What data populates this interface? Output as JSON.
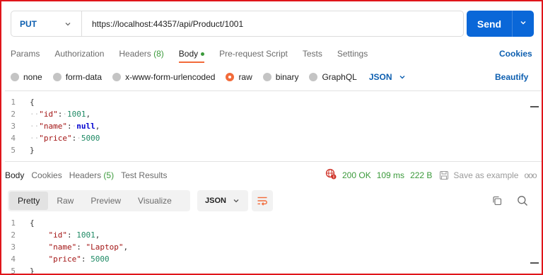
{
  "request": {
    "method": "PUT",
    "url": "https://localhost:44357/api/Product/1001",
    "send_label": "Send"
  },
  "request_tabs": [
    {
      "label": "Params"
    },
    {
      "label": "Authorization"
    },
    {
      "label": "Headers",
      "count": "(8)"
    },
    {
      "label": "Body",
      "active": true
    },
    {
      "label": "Pre-request Script"
    },
    {
      "label": "Tests"
    },
    {
      "label": "Settings"
    }
  ],
  "cookies_label": "Cookies",
  "body_types": [
    "none",
    "form-data",
    "x-www-form-urlencoded",
    "raw",
    "binary",
    "GraphQL"
  ],
  "selected_body_type": "raw",
  "body_format": "JSON",
  "beautify_label": "Beautify",
  "request_body": [
    {
      "n": "1",
      "text": "{"
    },
    {
      "n": "2",
      "key": "\"id\"",
      "value": "1001",
      "vtype": "num",
      "comma": ","
    },
    {
      "n": "3",
      "key": "\"name\"",
      "value": "null",
      "vtype": "kw",
      "comma": ","
    },
    {
      "n": "4",
      "key": "\"price\"",
      "value": "5000",
      "vtype": "num",
      "comma": ""
    },
    {
      "n": "5",
      "text": "}"
    }
  ],
  "response_tabs": [
    {
      "label": "Body",
      "active": true
    },
    {
      "label": "Cookies"
    },
    {
      "label": "Headers",
      "count": "(5)"
    },
    {
      "label": "Test Results"
    }
  ],
  "response_status": {
    "status": "200 OK",
    "time": "109 ms",
    "size": "222 B",
    "save_label": "Save as example",
    "more": "ooo"
  },
  "view_options": [
    "Pretty",
    "Raw",
    "Preview",
    "Visualize"
  ],
  "active_view": "Pretty",
  "response_format": "JSON",
  "response_body": [
    {
      "n": "1",
      "text": "{"
    },
    {
      "n": "2",
      "key": "\"id\"",
      "value": "1001",
      "vtype": "num",
      "comma": ","
    },
    {
      "n": "3",
      "key": "\"name\"",
      "value": "\"Laptop\"",
      "vtype": "str",
      "comma": ","
    },
    {
      "n": "4",
      "key": "\"price\"",
      "value": "5000",
      "vtype": "num",
      "comma": ""
    },
    {
      "n": "5",
      "text": "}"
    }
  ],
  "colors": {
    "accent": "#f26b3a",
    "send_button": "#0a67d8",
    "method": "#0d5fb0",
    "success": "#3b9a3b",
    "frame_border": "#e0151b"
  },
  "icons": {
    "method_dropdown": "chevron-down-icon",
    "send_dropdown": "chevron-down-icon",
    "globe_warning": "globe-icon",
    "save": "save-icon",
    "wrap": "wrap-lines-icon",
    "copy": "copy-icon",
    "search": "search-icon"
  }
}
